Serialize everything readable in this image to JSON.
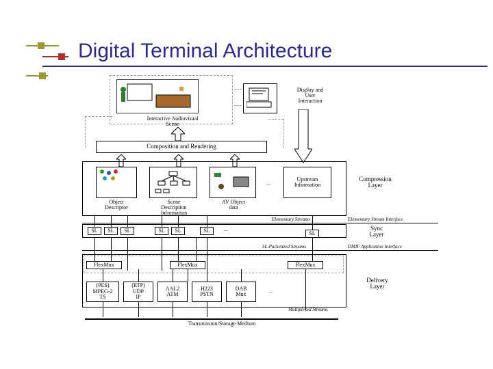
{
  "title": "Digital Terminal Architecture",
  "top": {
    "scene_label": "Interactive Audiovisual\nScene",
    "display_label": "Display and\nUser\nInteraction"
  },
  "comp_rend": "Composition and Rendering",
  "mid": {
    "obj_desc": "Object\nDescriptor",
    "scene_desc": "Scene\nDescription\nInformation",
    "av_obj": "AV Object\ndata",
    "upstream": "Upstream\nInformation",
    "comp_layer": "Compression\nLayer",
    "dots": "...",
    "es_label": "Elementary Streams",
    "es_interface": "Elementary Stream Interface"
  },
  "sl_row": {
    "sl": "SL",
    "sync_layer": "Sync\nLayer",
    "dots": "...",
    "packetized": "SL-Packetized Streams",
    "dmif": "DMIF Application Interface"
  },
  "flex": {
    "flexmux": "FlexMux",
    "delivery": "Delivery\nLayer",
    "pes": "(PES)\nMPEG-2\nTS",
    "rtp": "(RTP)\nUDP\nIP",
    "aal2": "AAL2\nATM",
    "h223": "H223\nPSTN",
    "dab": "DAB\nMux",
    "dots": "...",
    "mux_streams": "Multiplexed Streams",
    "medium": "Transmission/Storage Medium"
  },
  "colors": {
    "olive": "#9a9a33",
    "red": "#b03030",
    "blue": "#2b2b8b"
  }
}
